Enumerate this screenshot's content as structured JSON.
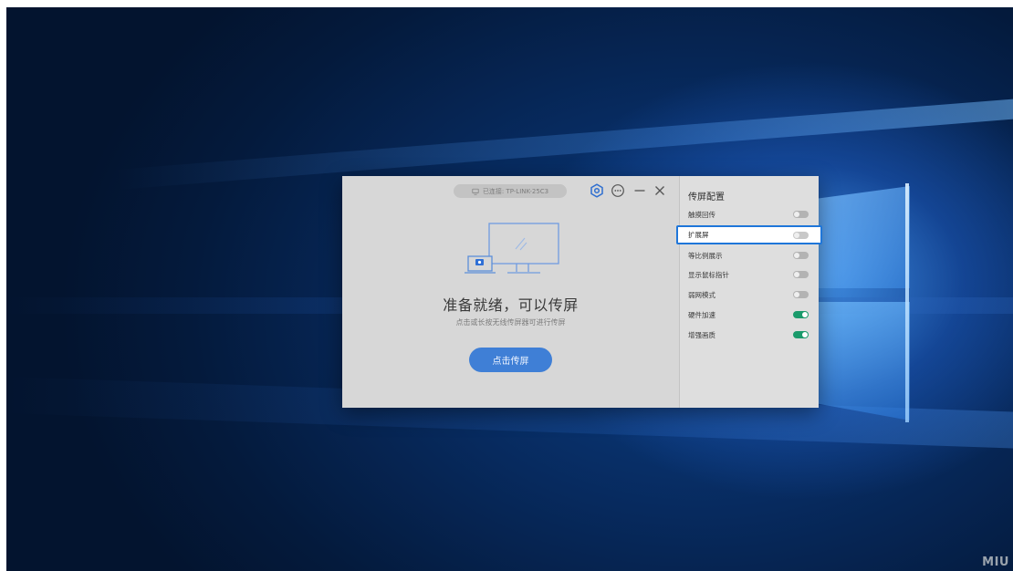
{
  "connection": {
    "status_text": "已连接: TP-LINK-25C3",
    "icon": "monitor-icon"
  },
  "titlebar": {
    "settings_icon": "settings-icon",
    "more_icon": "more-icon",
    "minimize_icon": "minimize-icon",
    "close_icon": "close-icon"
  },
  "main": {
    "title": "准备就绪，可以传屏",
    "subtitle": "点击或长按无线传屏器可进行传屏",
    "cast_button": "点击传屏"
  },
  "config": {
    "title": "传屏配置",
    "items": [
      {
        "label": "触摸回传",
        "enabled": false
      },
      {
        "label": "扩展屏",
        "enabled": false,
        "highlighted": true
      },
      {
        "label": "等比例展示",
        "enabled": false
      },
      {
        "label": "显示鼠标指针",
        "enabled": false
      },
      {
        "label": "弱网模式",
        "enabled": false
      },
      {
        "label": "硬件加速",
        "enabled": true
      },
      {
        "label": "增强画质",
        "enabled": true
      }
    ]
  },
  "watermark": "MIU",
  "colors": {
    "accent": "#3f7fd6",
    "toggle_on": "#1a9a6b",
    "highlight_border": "#1f76d9"
  }
}
